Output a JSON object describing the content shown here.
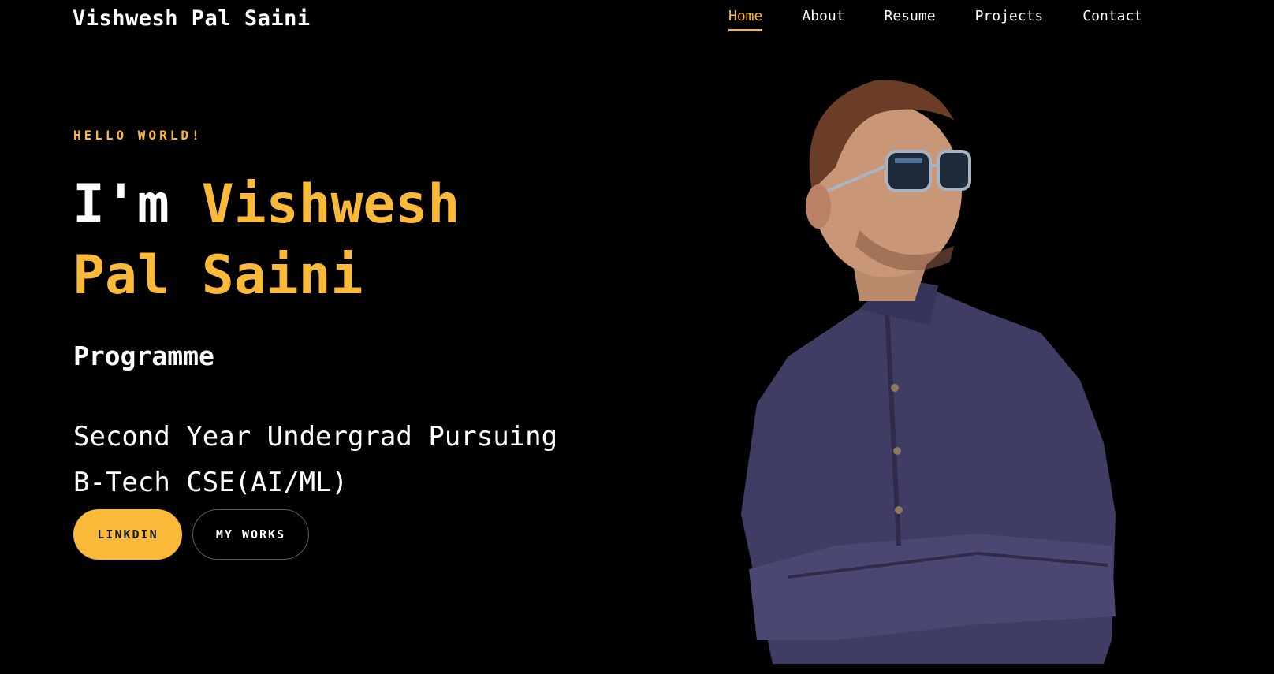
{
  "header": {
    "brand": "Vishwesh Pal Saini",
    "nav": [
      {
        "label": "Home",
        "active": true
      },
      {
        "label": "About",
        "active": false
      },
      {
        "label": "Resume",
        "active": false
      },
      {
        "label": "Projects",
        "active": false
      },
      {
        "label": "Contact",
        "active": false
      }
    ]
  },
  "hero": {
    "kicker": "HELLO WORLD!",
    "greeting": "I'm ",
    "name_line1": "Vishwesh",
    "name_line2": "Pal Saini",
    "role": "Programme",
    "description_line1": "Second Year Undergrad Pursuing",
    "description_line2": "B-Tech CSE(AI/ML)",
    "primary_button": "LINKDIN",
    "secondary_button": "MY WORKS"
  },
  "colors": {
    "accent": "#fbb93a",
    "background": "#000000",
    "text": "#ffffff"
  },
  "portrait": {
    "icon": "person-photo"
  }
}
